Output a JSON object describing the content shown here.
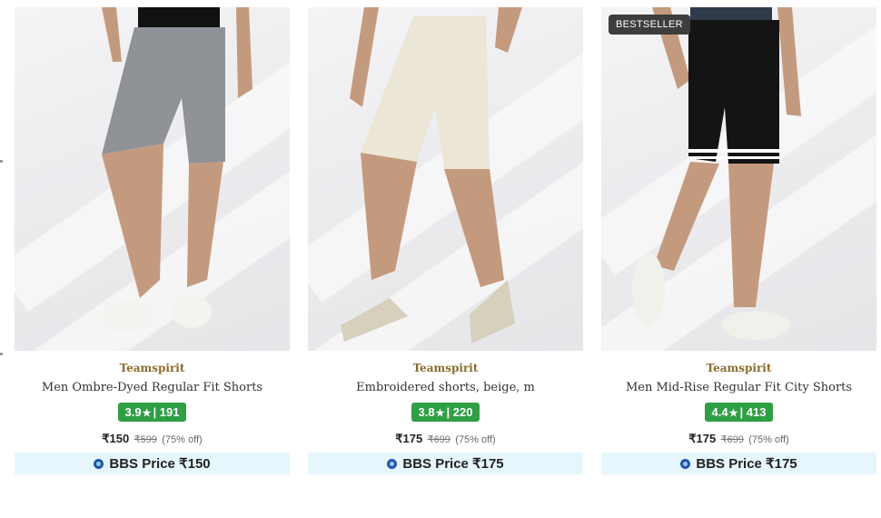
{
  "products": [
    {
      "brand": "Teamspirit",
      "title": "Men Ombre-Dyed Regular Fit Shorts",
      "rating": "3.9",
      "reviews": "191",
      "price": "₹150",
      "mrp": "₹599",
      "discount": "(75% off)",
      "bbs_label": "BBS Price ₹150",
      "shorts_color": "#8f9397",
      "badge": ""
    },
    {
      "brand": "Teamspirit",
      "title": "Embroidered shorts, beige, m",
      "rating": "3.8",
      "reviews": "220",
      "price": "₹175",
      "mrp": "₹699",
      "discount": "(75% off)",
      "bbs_label": "BBS Price ₹175",
      "shorts_color": "#ece6d6",
      "badge": ""
    },
    {
      "brand": "Teamspirit",
      "title": "Men Mid-Rise Regular Fit City Shorts",
      "rating": "4.4",
      "reviews": "413",
      "price": "₹175",
      "mrp": "₹699",
      "discount": "(75% off)",
      "bbs_label": "BBS Price ₹175",
      "shorts_color": "#141414",
      "badge": "BESTSELLER"
    }
  ],
  "rating_star": "★",
  "rating_separator": "|",
  "colors": {
    "rating_bg": "#2f9e44",
    "bbs_bg": "#e6f6fd",
    "brand_text": "#8a6c2e"
  }
}
